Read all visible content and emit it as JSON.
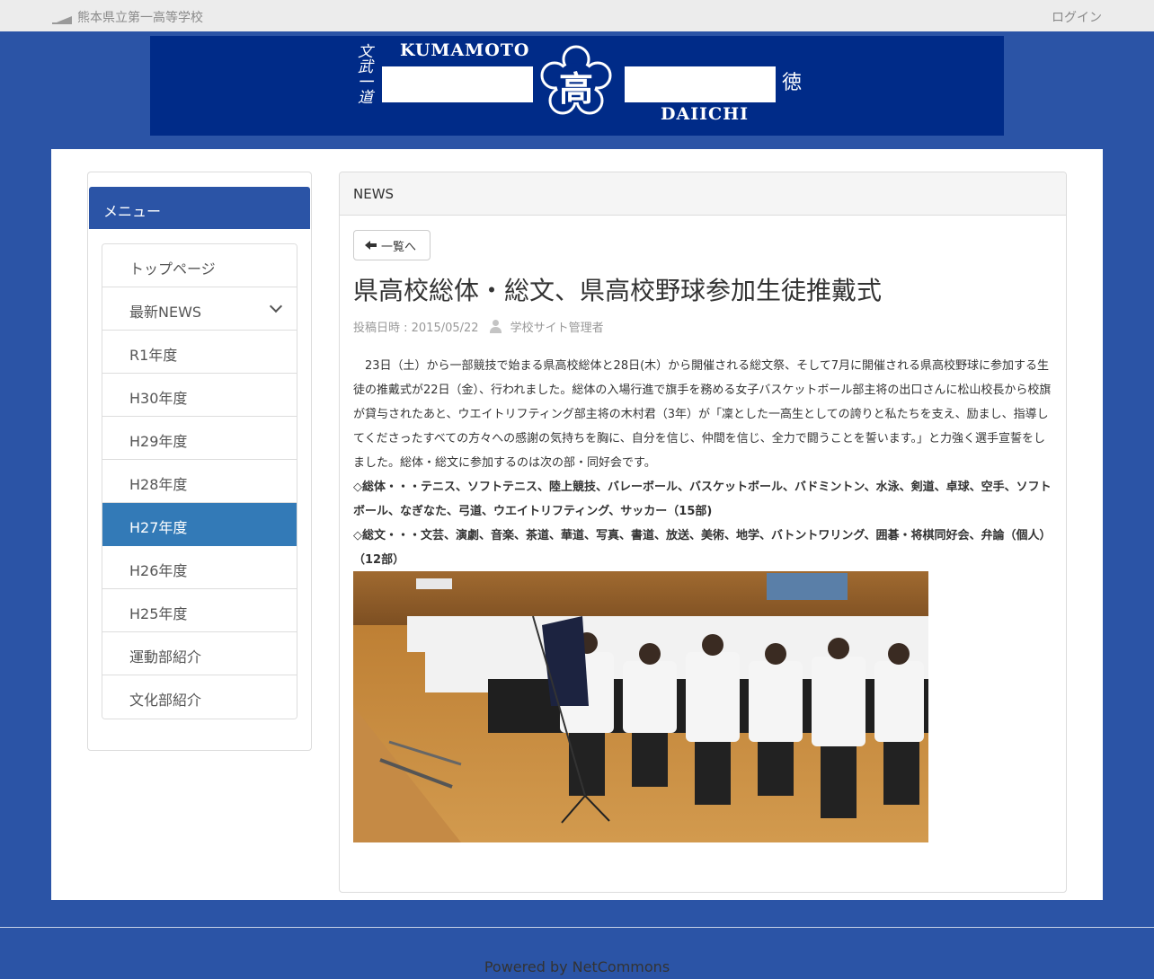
{
  "header": {
    "site_title": "熊本県立第一高等学校",
    "login_label": "ログイン"
  },
  "banner": {
    "text_top": "KUMAMOTO",
    "text_bottom": "DAIICHI",
    "emblem_char": "高",
    "vertical_left": "文武一道",
    "vertical_right": "徳"
  },
  "sidebar": {
    "heading": "メニュー",
    "items": [
      {
        "label": "トップページ"
      },
      {
        "label": "最新NEWS"
      },
      {
        "label": "R1年度"
      },
      {
        "label": "H30年度"
      },
      {
        "label": "H29年度"
      },
      {
        "label": "H28年度"
      },
      {
        "label": "H27年度"
      },
      {
        "label": "H26年度"
      },
      {
        "label": "H25年度"
      },
      {
        "label": "運動部紹介"
      },
      {
        "label": "文化部紹介"
      }
    ],
    "active_item": "H27年度"
  },
  "content": {
    "panel_title": "NEWS",
    "back_label": "一覧へ",
    "article_title": "県高校総体・総文、県高校野球参加生徒推戴式",
    "posted_date": "投稿日時 : 2015/05/22",
    "author": "学校サイト管理者",
    "paragraph": "　23日（土）から一部競技で始まる県高校総体と28日(木）から開催される総文祭、そして7月に開催される県高校野球に参加する生徒の推戴式が22日（金）、行われました。総体の入場行進で旗手を務める女子バスケットボール部主将の出口さんに松山校長から校旗が貸与されたあと、ウエイトリフティング部主将の木村君（3年）が「凜とした一高生としての誇りと私たちを支え、励まし、指導してくださったすべての方々への感謝の気持ちを胸に、自分を信じ、仲間を信じ、全力で闘うことを誓います。」と力強く選手宣誓をしました。総体・総文に参加するのは次の部・同好会です。",
    "sports_list": "◇総体・・・テニス、ソフトテニス、陸上競技、バレーボール、バスケットボール、バドミントン、水泳、剣道、卓球、空手、ソフトボール、なぎなた、弓道、ウエイトリフティング、サッカー（15部)",
    "culture_list": "◇総文・・・文芸、演劇、音楽、茶道、華道、写真、書道、放送、美術、地学、バトントワリング、囲碁・将棋同好会、弁論（個人）（12部）"
  },
  "footer": {
    "powered_by": "Powered by NetCommons"
  },
  "colors": {
    "page_bg": "#2b54a6",
    "banner_bg": "#002b88",
    "active_menu": "#337ab7"
  }
}
